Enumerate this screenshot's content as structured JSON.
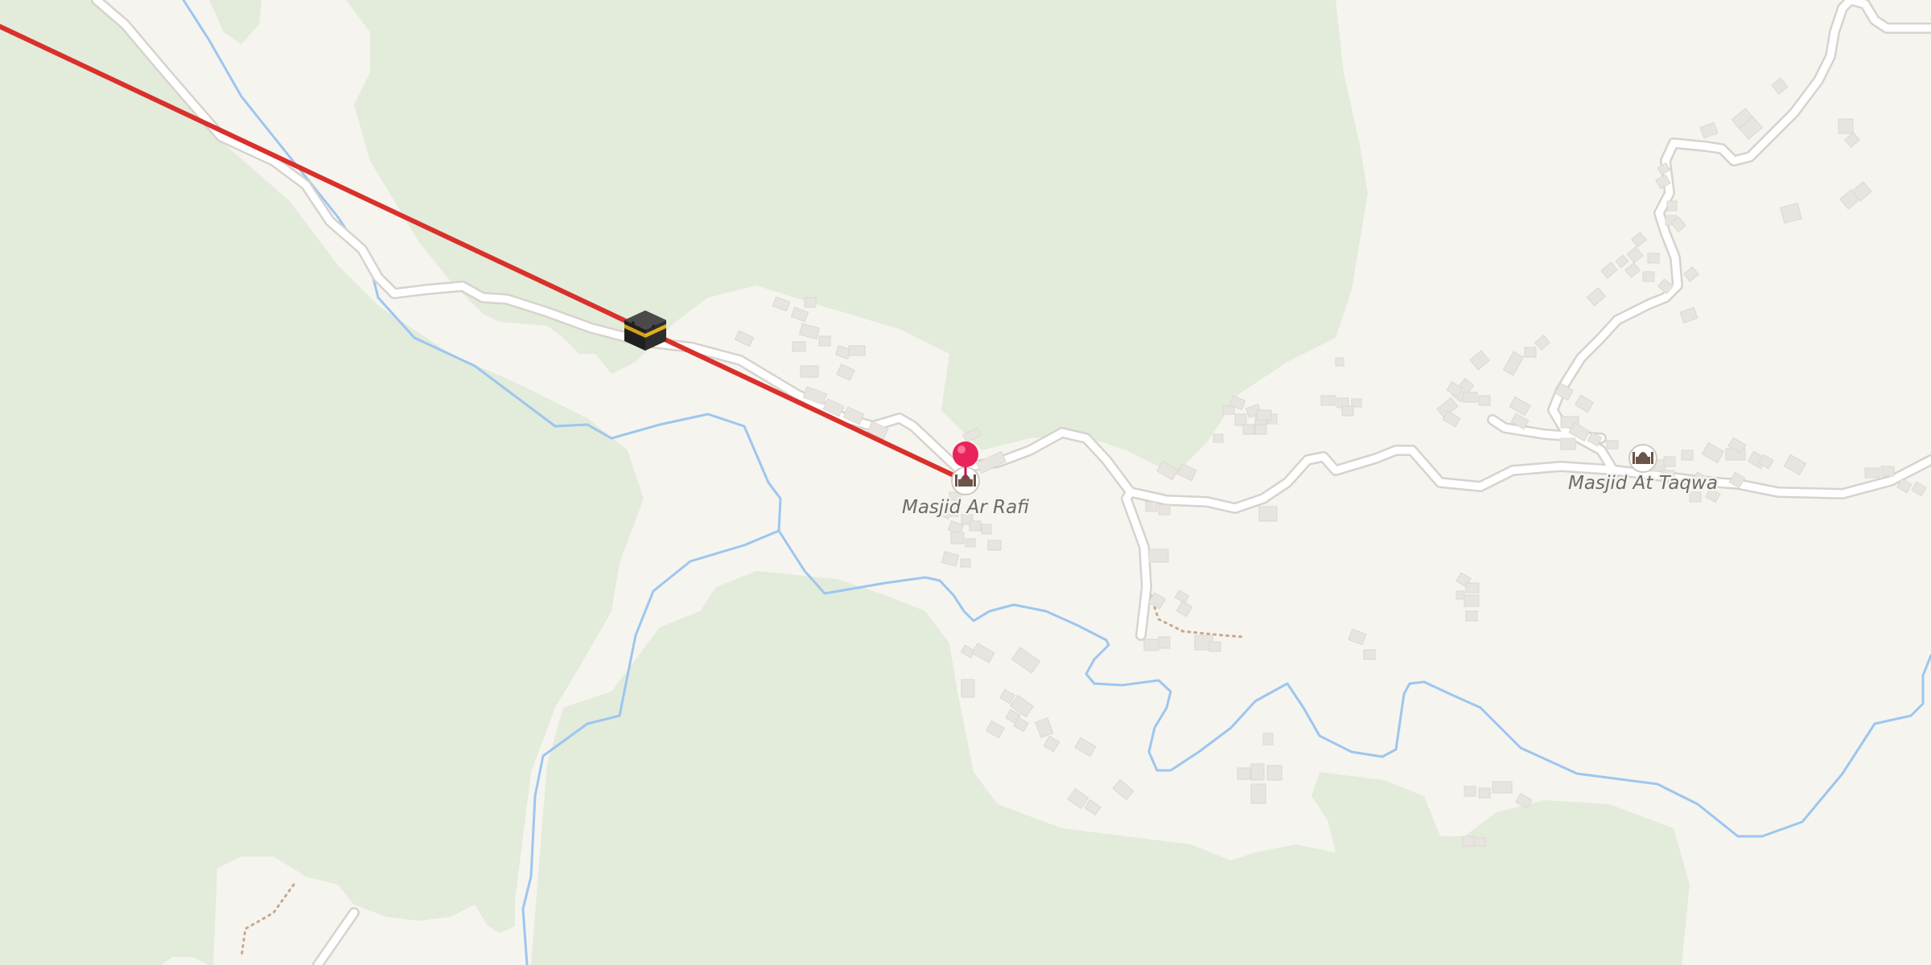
{
  "map": {
    "colors": {
      "land": "#f6f4ef",
      "forest": "#e3ebdb",
      "water": "#9cc6ef",
      "road_fill": "#ffffff",
      "road_casing": "#d7d3cc",
      "building": "#e8e5e0",
      "path": "#c9a98c",
      "qibla_line": "#d9302b",
      "pin": "#e8245a"
    },
    "pois": [
      {
        "id": "masjid-ar-rafi",
        "label": "Masjid Ar Rafi",
        "icon": "mosque-icon"
      },
      {
        "id": "masjid-at-taqwa",
        "label": "Masjid At Taqwa",
        "icon": "mosque-icon"
      }
    ],
    "markers": {
      "location_pin": {
        "icon": "map-pin-icon"
      },
      "kaaba": {
        "icon": "kaaba-icon"
      }
    }
  }
}
